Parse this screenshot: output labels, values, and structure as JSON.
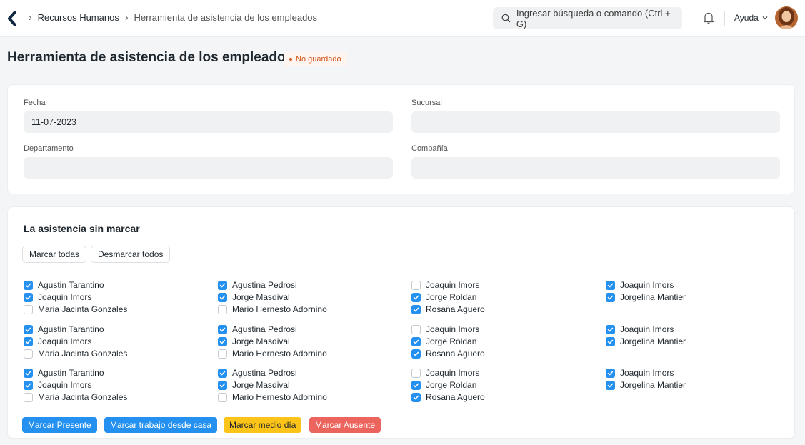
{
  "nav": {
    "crumbs": [
      "Recursos Humanos",
      "Herramienta de asistencia de los empleados"
    ],
    "search_placeholder": "Ingresar búsqueda o comando (Ctrl + G)",
    "help_label": "Ayuda"
  },
  "page": {
    "title": "Herramienta de asistencia de los empleados",
    "status": "No guardado"
  },
  "form": {
    "fecha_label": "Fecha",
    "fecha_value": "11-07-2023",
    "sucursal_label": "Sucursal",
    "sucursal_value": "",
    "departamento_label": "Departamento",
    "departamento_value": "",
    "compania_label": "Compañía",
    "compania_value": ""
  },
  "attendance": {
    "title": "La asistencia sin marcar",
    "mark_all": "Marcar todas",
    "unmark_all": "Desmarcar todos",
    "groups": [
      {
        "columns": [
          [
            {
              "name": "Agustin Tarantino",
              "checked": true
            },
            {
              "name": "Joaquin Imors",
              "checked": true
            },
            {
              "name": "Maria Jacinta Gonzales",
              "checked": false
            }
          ],
          [
            {
              "name": "Agustina Pedrosi",
              "checked": true
            },
            {
              "name": "Jorge Masdival",
              "checked": true
            },
            {
              "name": "Mario Hernesto Adornino",
              "checked": false
            }
          ],
          [
            {
              "name": "Joaquin Imors",
              "checked": false
            },
            {
              "name": "Jorge Roldan",
              "checked": true
            },
            {
              "name": "Rosana Aguero",
              "checked": true
            }
          ],
          [
            {
              "name": "Joaquin Imors",
              "checked": true
            },
            {
              "name": "Jorgelina Mantier",
              "checked": true
            }
          ]
        ]
      },
      {
        "columns": [
          [
            {
              "name": "Agustin Tarantino",
              "checked": true
            },
            {
              "name": "Joaquin Imors",
              "checked": true
            },
            {
              "name": "Maria Jacinta Gonzales",
              "checked": false
            }
          ],
          [
            {
              "name": "Agustina Pedrosi",
              "checked": true
            },
            {
              "name": "Jorge Masdival",
              "checked": true
            },
            {
              "name": "Mario Hernesto Adornino",
              "checked": false
            }
          ],
          [
            {
              "name": "Joaquin Imors",
              "checked": false
            },
            {
              "name": "Jorge Roldan",
              "checked": true
            },
            {
              "name": "Rosana Aguero",
              "checked": true
            }
          ],
          [
            {
              "name": "Joaquin Imors",
              "checked": true
            },
            {
              "name": "Jorgelina Mantier",
              "checked": true
            }
          ]
        ]
      },
      {
        "columns": [
          [
            {
              "name": "Agustin Tarantino",
              "checked": true
            },
            {
              "name": "Joaquin Imors",
              "checked": true
            },
            {
              "name": "Maria Jacinta Gonzales",
              "checked": false
            }
          ],
          [
            {
              "name": "Agustina Pedrosi",
              "checked": true
            },
            {
              "name": "Jorge Masdival",
              "checked": true
            },
            {
              "name": "Mario Hernesto Adornino",
              "checked": false
            }
          ],
          [
            {
              "name": "Joaquin Imors",
              "checked": false
            },
            {
              "name": "Jorge Roldan",
              "checked": true
            },
            {
              "name": "Rosana Aguero",
              "checked": true
            }
          ],
          [
            {
              "name": "Joaquin Imors",
              "checked": true
            },
            {
              "name": "Jorgelina Mantier",
              "checked": true
            }
          ]
        ]
      }
    ],
    "actions": {
      "present": "Marcar Presente",
      "wfh": "Marcar trabajo desde casa",
      "half_day": "Marcar medio día",
      "absent": "Marcar Ausente"
    }
  },
  "colors": {
    "primary": "#2490ef",
    "warning": "#fcc419",
    "danger": "#ec645e",
    "status_orange": "#d2551c"
  }
}
